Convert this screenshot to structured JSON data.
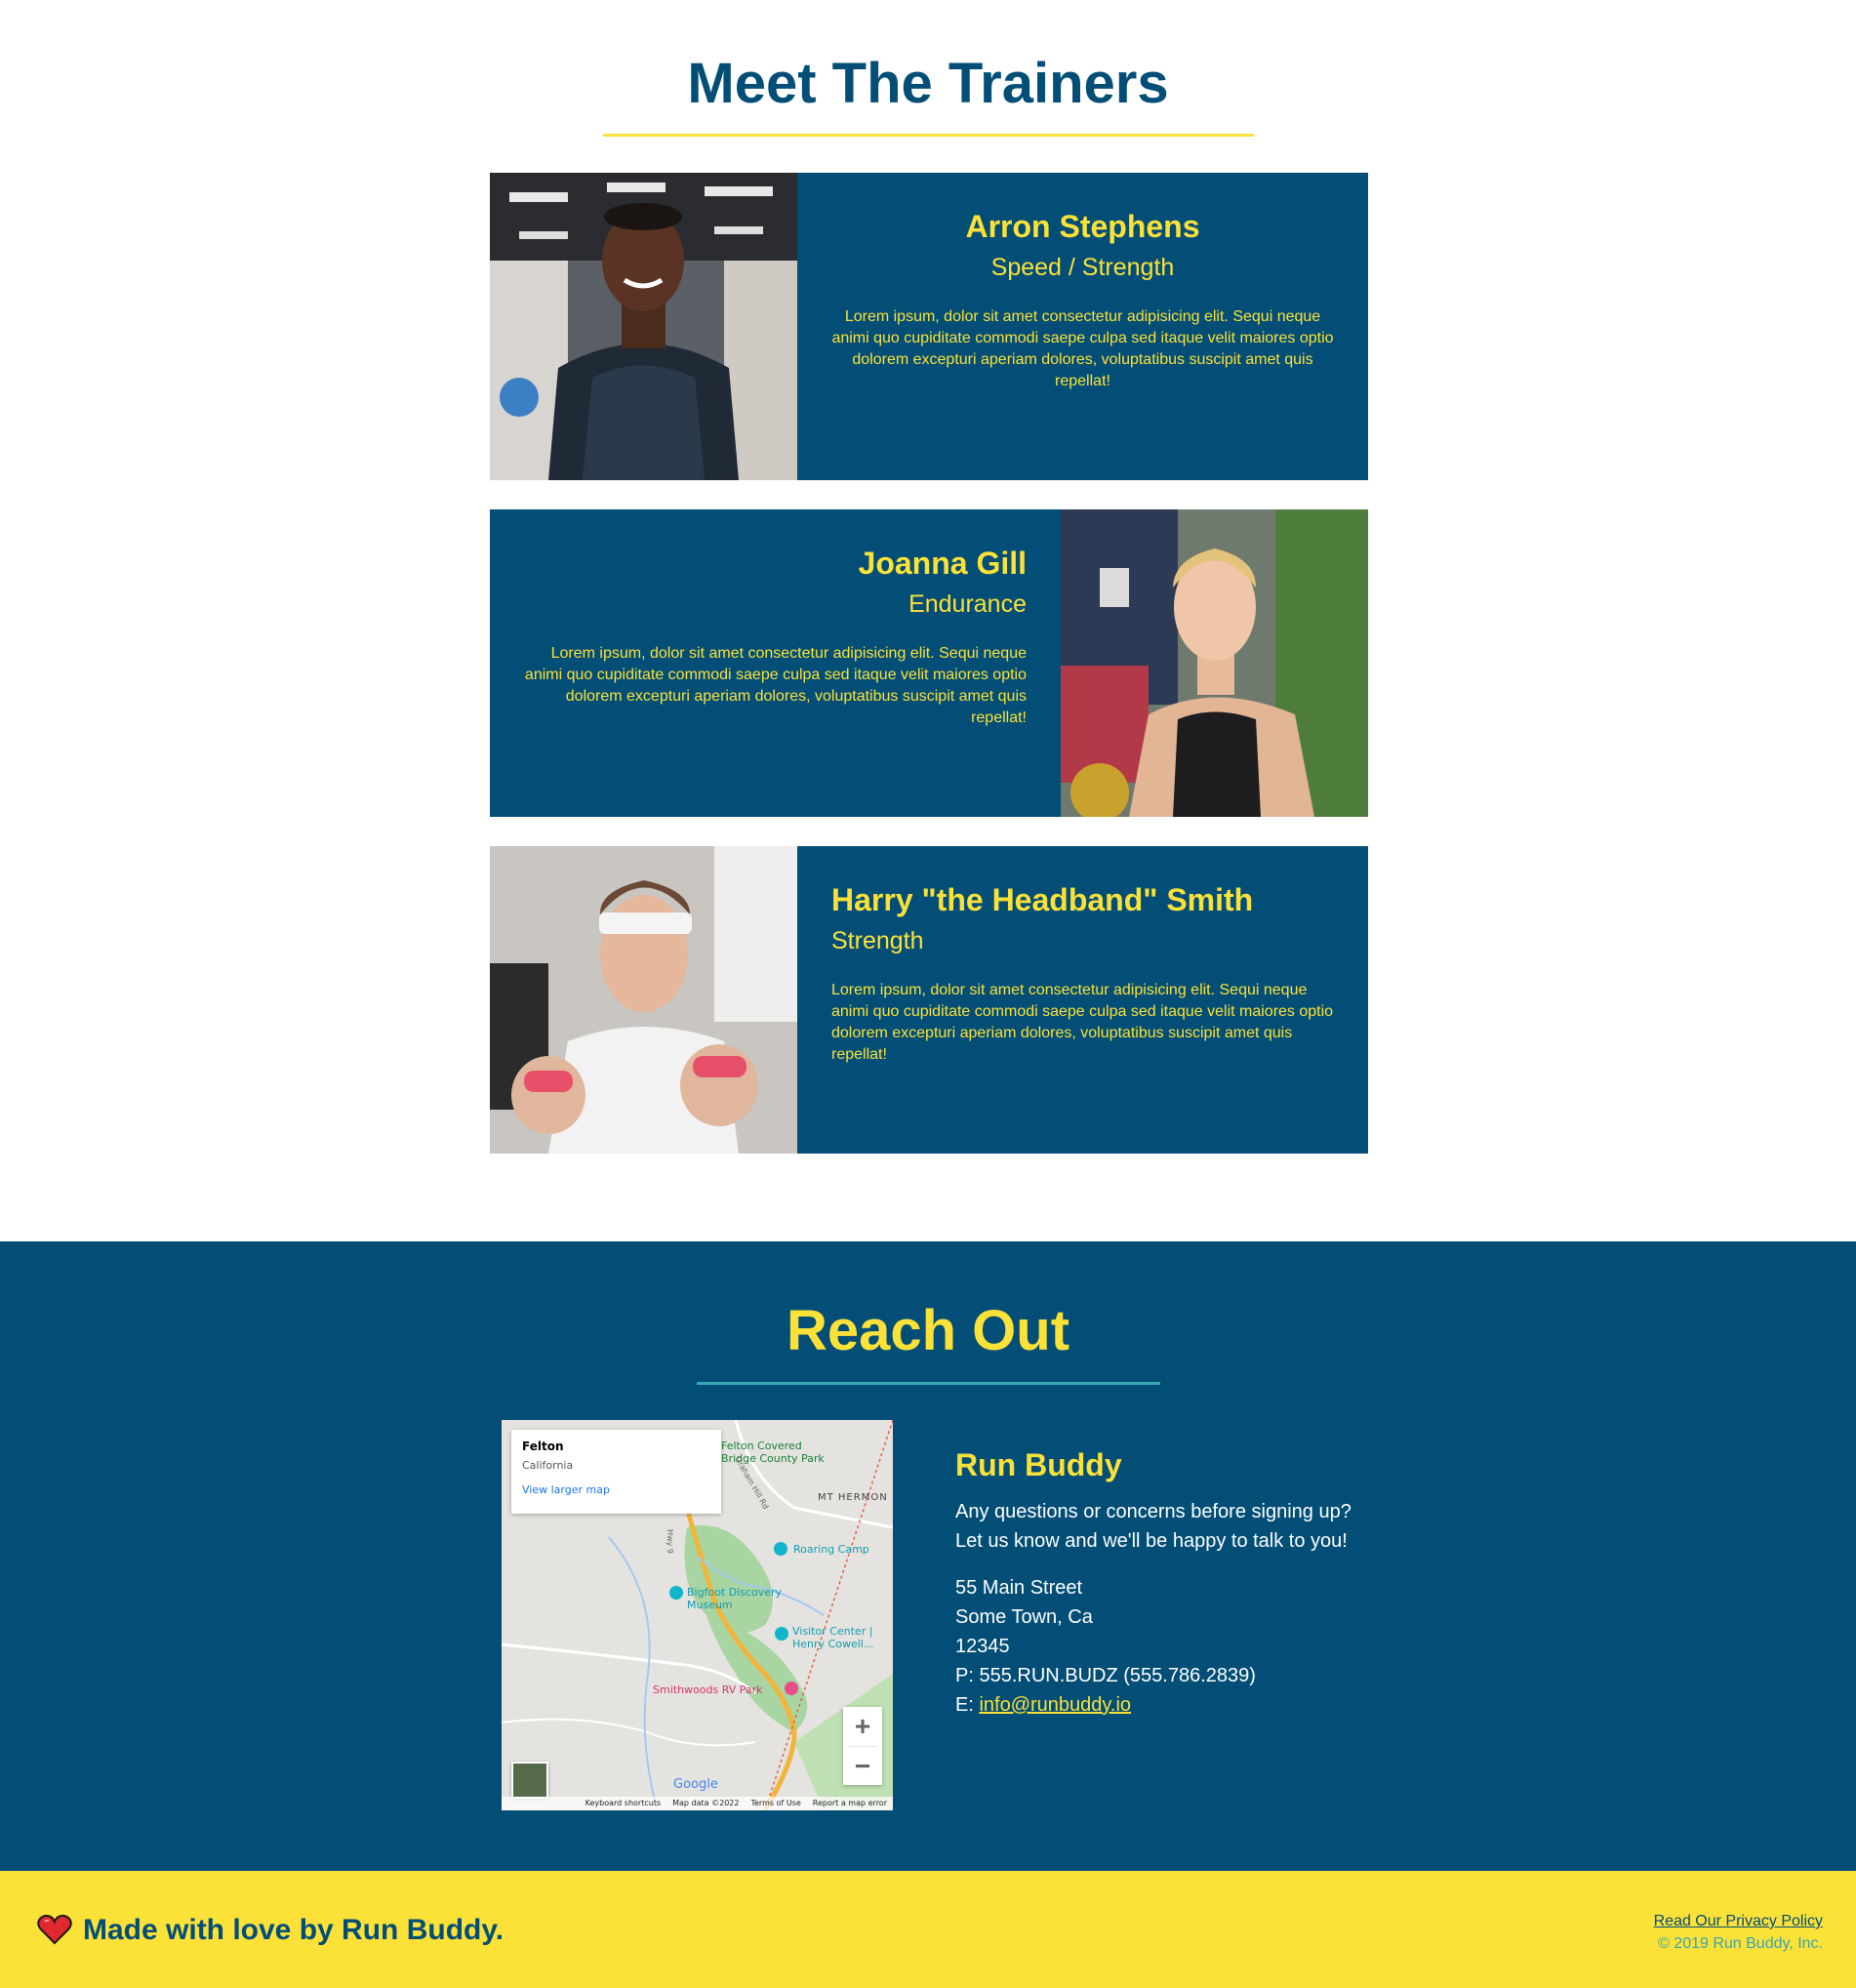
{
  "trainers": {
    "title": "Meet The Trainers",
    "items": [
      {
        "name": "Arron Stephens",
        "role": "Speed / Strength",
        "bio": "Lorem ipsum, dolor sit amet consectetur adipisicing elit. Sequi neque animi quo cupiditate commodi saepe culpa sed itaque velit maiores optio dolorem excepturi aperiam dolores, voluptatibus suscipit amet quis repellat!"
      },
      {
        "name": "Joanna Gill",
        "role": "Endurance",
        "bio": "Lorem ipsum, dolor sit amet consectetur adipisicing elit. Sequi neque animi quo cupiditate commodi saepe culpa sed itaque velit maiores optio dolorem excepturi aperiam dolores, voluptatibus suscipit amet quis repellat!"
      },
      {
        "name": "Harry \"the Headband\" Smith",
        "role": "Strength",
        "bio": "Lorem ipsum, dolor sit amet consectetur adipisicing elit. Sequi neque animi quo cupiditate commodi saepe culpa sed itaque velit maiores optio dolorem excepturi aperiam dolores, voluptatibus suscipit amet quis repellat!"
      }
    ]
  },
  "contact": {
    "title": "Reach Out",
    "map": {
      "place": "Felton",
      "region": "California",
      "larger_link": "View larger map",
      "labels": {
        "covered_bridge": "Felton Covered Bridge County Park",
        "mt_hermon": "MT HERMON",
        "roaring_camp": "Roaring Camp",
        "bigfoot": "Bigfoot Discovery Museum",
        "visitor_center": "Visitor Center | Henry Cowell...",
        "smithwoods": "Smithwoods RV Park",
        "graham_hill": "Graham Hill Rd",
        "hwy9": "Hwy 9"
      },
      "google": "Google",
      "attrib_keyboard": "Keyboard shortcuts",
      "attrib_data": "Map data ©2022",
      "attrib_terms": "Terms of Use",
      "attrib_report": "Report a map error",
      "zoom_in": "+",
      "zoom_out": "−"
    },
    "company": "Run Buddy",
    "intro_line1": "Any questions or concerns before signing up?",
    "intro_line2": "Let us know and we'll be happy to talk to you!",
    "street": "55 Main Street",
    "city": "Some Town, Ca",
    "zip": "12345",
    "phone": "P: 555.RUN.BUDZ (555.786.2839)",
    "email_prefix": "E: ",
    "email": "info@runbuddy.io"
  },
  "footer": {
    "made_with_love": "Made with love by Run Buddy.",
    "privacy": "Read Our Privacy Policy",
    "copyright": "© 2019 Run Buddy, Inc."
  },
  "colors": {
    "primary": "#024e76",
    "accent": "#fce138",
    "secondary": "#39a6b2"
  },
  "icons": [
    "heart-icon",
    "zoom-in-icon",
    "zoom-out-icon",
    "map-pin-icon"
  ]
}
